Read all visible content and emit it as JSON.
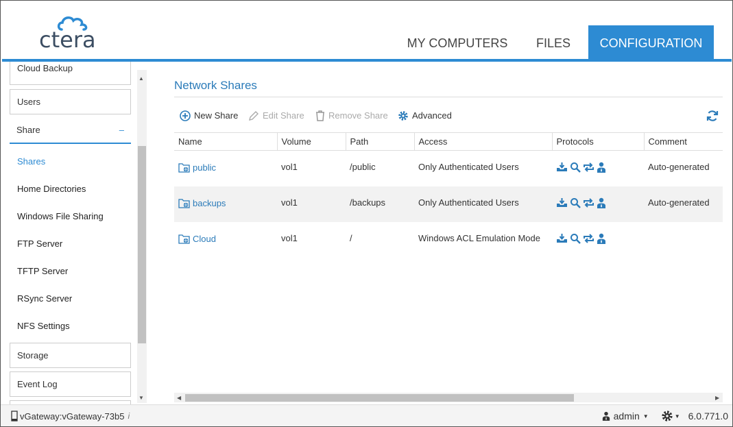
{
  "logo": {
    "text": "ctera"
  },
  "nav": {
    "tabs": [
      {
        "label": "MY COMPUTERS",
        "active": false
      },
      {
        "label": "FILES",
        "active": false
      },
      {
        "label": "CONFIGURATION",
        "active": true
      }
    ]
  },
  "sidebar": {
    "top_partial": "Cloud Backup",
    "items": [
      {
        "label": "Users"
      },
      {
        "label": "Share",
        "expanded_symbol": "–"
      }
    ],
    "sub_items": [
      {
        "label": "Shares",
        "active": true
      },
      {
        "label": "Home Directories"
      },
      {
        "label": "Windows File Sharing"
      },
      {
        "label": "FTP Server"
      },
      {
        "label": "TFTP Server"
      },
      {
        "label": "RSync Server"
      },
      {
        "label": "NFS Settings"
      }
    ],
    "bottom_items": [
      {
        "label": "Storage"
      },
      {
        "label": "Event Log"
      }
    ]
  },
  "main": {
    "title": "Network Shares",
    "toolbar": {
      "new_share": "New Share",
      "edit_share": "Edit Share",
      "remove_share": "Remove Share",
      "advanced": "Advanced"
    },
    "columns": [
      "Name",
      "Volume",
      "Path",
      "Access",
      "Protocols",
      "Comment"
    ],
    "rows": [
      {
        "name": "public",
        "volume": "vol1",
        "path": "/public",
        "access": "Only Authenticated Users",
        "comment": "Auto-generated"
      },
      {
        "name": "backups",
        "volume": "vol1",
        "path": "/backups",
        "access": "Only Authenticated Users",
        "comment": "Auto-generated"
      },
      {
        "name": "Cloud",
        "volume": "vol1",
        "path": "/",
        "access": "Windows ACL Emulation Mode",
        "comment": ""
      }
    ],
    "protocol_icons": [
      "download-tray-icon",
      "search-icon",
      "sync-arrows-icon",
      "user-tie-icon"
    ]
  },
  "status": {
    "device": "vGateway:vGateway-73b5",
    "user": "admin",
    "version": "6.0.771.0"
  },
  "colors": {
    "accent": "#2d8bd3",
    "link": "#2b7bb9",
    "logo": "#3c4e63"
  }
}
